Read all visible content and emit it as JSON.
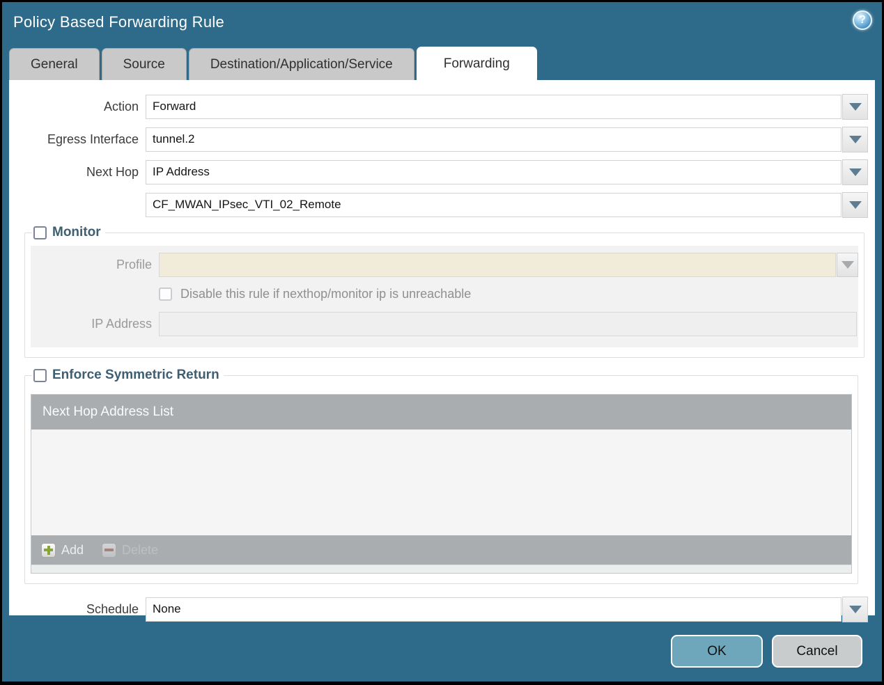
{
  "window": {
    "title": "Policy Based Forwarding Rule"
  },
  "icons": {
    "help_glyph": "?"
  },
  "tabs": [
    {
      "label": "General",
      "active": false
    },
    {
      "label": "Source",
      "active": false
    },
    {
      "label": "Destination/Application/Service",
      "active": false
    },
    {
      "label": "Forwarding",
      "active": true
    }
  ],
  "form": {
    "action": {
      "label": "Action",
      "value": "Forward"
    },
    "egress_interface": {
      "label": "Egress Interface",
      "value": "tunnel.2"
    },
    "next_hop": {
      "label": "Next Hop",
      "value": "IP Address"
    },
    "next_hop_address": {
      "value": "CF_MWAN_IPsec_VTI_02_Remote"
    },
    "schedule": {
      "label": "Schedule",
      "value": "None"
    }
  },
  "monitor": {
    "legend": "Monitor",
    "profile_label": "Profile",
    "profile_value": "",
    "disable_checkbox_label": "Disable this rule if nexthop/monitor ip is unreachable",
    "ip_address_label": "IP Address",
    "ip_address_value": ""
  },
  "symmetric_return": {
    "legend": "Enforce Symmetric Return",
    "table_header": "Next Hop Address List",
    "add_label": "Add",
    "delete_label": "Delete"
  },
  "buttons": {
    "ok": "OK",
    "cancel": "Cancel"
  },
  "colors": {
    "dialog_teal": "#2e6a8a",
    "ok_button": "#6ea7bc",
    "cancel_button": "#c9cccd",
    "table_header_gray": "#a9adb0",
    "disabled_field_beige": "#f1ecd9",
    "legend_text": "#3f5e72"
  }
}
